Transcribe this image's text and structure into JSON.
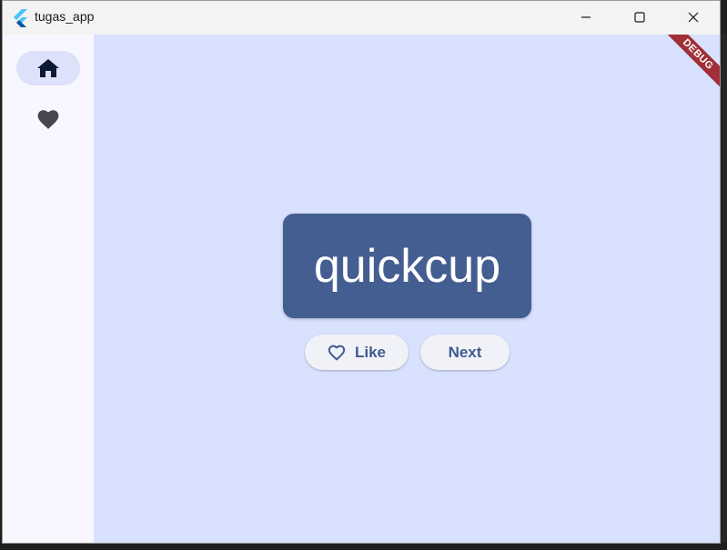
{
  "window": {
    "title": "tugas_app"
  },
  "rail": {
    "items": [
      {
        "icon": "home-icon",
        "selected": true
      },
      {
        "icon": "heart-icon",
        "selected": false
      }
    ]
  },
  "main": {
    "debug_label": "DEBUG",
    "word": "quickcup",
    "like_label": "Like",
    "next_label": "Next"
  },
  "colors": {
    "card": "#445e91",
    "main_bg": "#d8e1fd",
    "rail_bg": "#f8f7ff",
    "debug_banner": "#a02f37"
  }
}
